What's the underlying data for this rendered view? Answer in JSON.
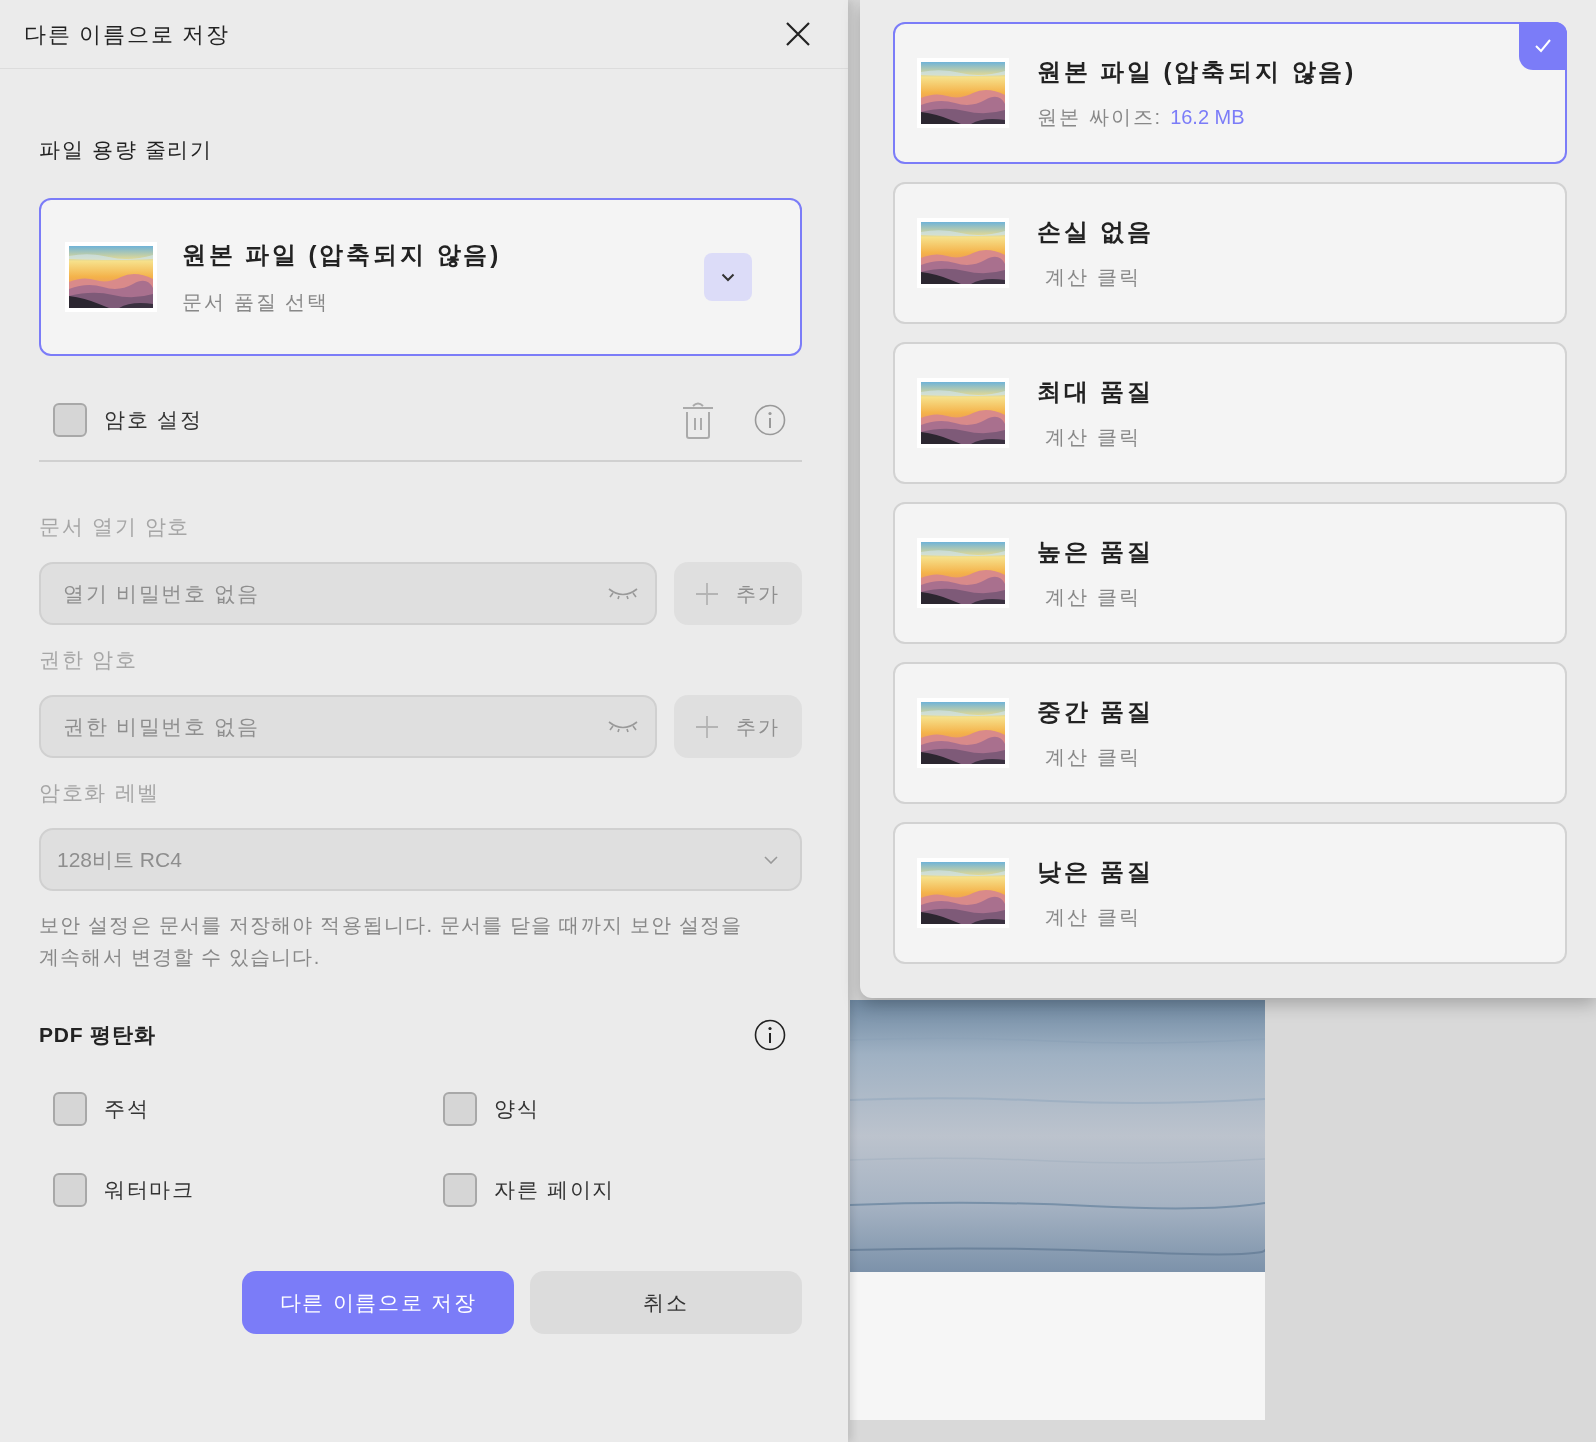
{
  "dialog": {
    "title": "다른 이름으로 저장"
  },
  "compression": {
    "heading": "파일 용량 줄리기",
    "title": "원본 파일 (압축되지 않음)",
    "subtitle": "문서 품질 선택"
  },
  "password": {
    "label": "암호 설정",
    "checked": false,
    "disabled": true,
    "fields": [
      {
        "label": "문서 열기 암호",
        "placeholder": "열기 비밀번호 없음",
        "add_button": "추가"
      },
      {
        "label": "권한 암호",
        "placeholder": "권한 비밀번호 없음",
        "add_button": "추가"
      }
    ],
    "encryption": {
      "label": "암호화 레벨",
      "value": "128비트 RC4"
    },
    "note": "보안 설정은 문서를 저장해야 적용됩니다. 문서를 닫을 때까지 보안 설정을 계속해서 변경할 수 있습니다."
  },
  "flatten": {
    "heading": "PDF 평탄화",
    "options": [
      {
        "label": "주석",
        "checked": false
      },
      {
        "label": "양식",
        "checked": false
      },
      {
        "label": "워터마크",
        "checked": false
      },
      {
        "label": "자른 페이지",
        "checked": false
      }
    ]
  },
  "buttons": [
    {
      "label": "다른 이름으로 저장",
      "kind": "primary"
    },
    {
      "label": "취소",
      "kind": "secondary"
    }
  ],
  "quality_menu": {
    "options": [
      {
        "title": "원본 파일 (압축되지 않음)",
        "detail": "원본 싸이즈:",
        "size": "16.2 MB",
        "selected": true
      },
      {
        "title": "손실 없음",
        "detail": "계산 클릭",
        "selected": false
      },
      {
        "title": "최대 품질",
        "detail": "계산 클릭",
        "selected": false
      },
      {
        "title": "높은 품질",
        "detail": "계산 클릭",
        "selected": false
      },
      {
        "title": "중간 품질",
        "detail": "계산 클릭",
        "selected": false
      },
      {
        "title": "낮은 품질",
        "detail": "계산 클릭",
        "selected": false
      }
    ]
  }
}
